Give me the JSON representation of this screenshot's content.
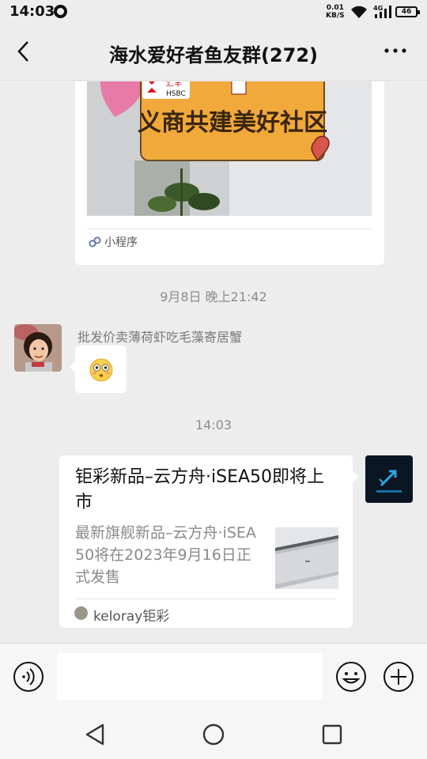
{
  "status_bar": {
    "time": "14:03",
    "net_speed_value": "0.01",
    "net_speed_unit": "KB/S",
    "network_type": "4G",
    "battery": "46",
    "icons": [
      "notification-icon",
      "wifi-icon",
      "signal-icon",
      "battery-icon"
    ]
  },
  "header": {
    "title": "海水爱好者鱼友群(272)",
    "back_icon": "chevron-left-icon",
    "more_icon": "more-dots-icon"
  },
  "messages": [
    {
      "type": "mini-program",
      "image_sign_text": "义商共建美好社区",
      "image_logos": [
        "汇丰",
        "HSBC"
      ],
      "footer_label": "小程序",
      "footer_icon": "mini-program-icon"
    },
    {
      "type": "timestamp",
      "text": "9月8日 晚上21:42"
    },
    {
      "type": "emoji",
      "sender": "批发价卖薄荷虾吃毛藻寄居蟹",
      "emoji_icon": "flushed-face-icon"
    },
    {
      "type": "timestamp",
      "text": "14:03"
    },
    {
      "type": "article",
      "title": "钜彩新品–云方舟·iSEA50即将上市",
      "description": "最新旗舰新品–云方舟·iSEA50将在2023年9月16日正式发售",
      "source": "keloray钜彩"
    }
  ],
  "input_bar": {
    "placeholder": "",
    "voice_icon": "voice-icon",
    "emoji_icon": "emoji-icon",
    "plus_icon": "plus-icon"
  },
  "nav_bar": {
    "icons": [
      "nav-back-icon",
      "nav-home-icon",
      "nav-recent-icon"
    ]
  },
  "colors": {
    "background": "#ededed",
    "bubble": "#ffffff",
    "timestamp_text": "#8c8c8c",
    "sign_orange": "#f0a93a"
  }
}
